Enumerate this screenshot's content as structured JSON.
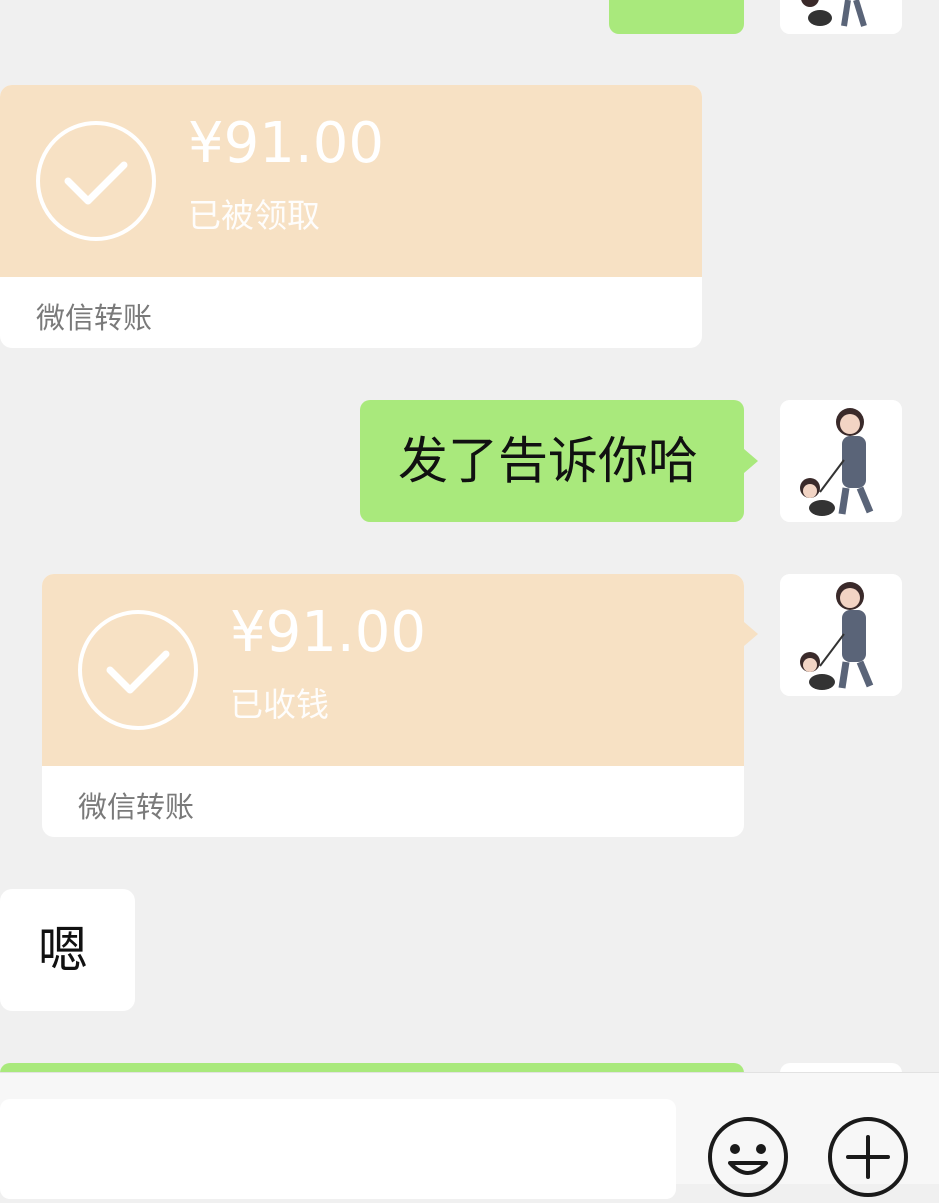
{
  "messages": {
    "top_partial": {
      "type": "outgoing-green"
    },
    "transfer_1": {
      "amount": "¥91.00",
      "status": "已被领取",
      "label": "微信转账"
    },
    "outgoing_text": {
      "text": "发了告诉你哈"
    },
    "transfer_2": {
      "amount": "¥91.00",
      "status": "已收钱",
      "label": "微信转账"
    },
    "incoming_text": {
      "text": "嗯"
    },
    "bottom_partial": {
      "type": "outgoing-green"
    }
  },
  "input_bar": {
    "emoji_icon": "emoji-icon",
    "plus_icon": "plus-icon"
  },
  "colors": {
    "background": "#f0f0f0",
    "outgoing_bubble": "#a9e97c",
    "transfer_card": "#f7e1c4",
    "incoming_bubble": "#ffffff"
  }
}
